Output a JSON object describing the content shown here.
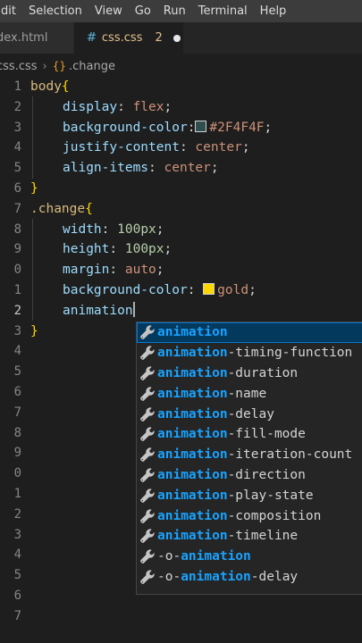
{
  "menu": [
    "dit",
    "Selection",
    "View",
    "Go",
    "Run",
    "Terminal",
    "Help"
  ],
  "tabs": {
    "inactive_label": "dex.html",
    "active_icon": "#",
    "active_label": "css.css",
    "active_problems": "2"
  },
  "breadcrumb": {
    "file": "css.css",
    "symbol": ".change"
  },
  "line_numbers": [
    "1",
    "2",
    "3",
    "4",
    "5",
    "6",
    "7",
    "8",
    "9",
    "0",
    "1",
    "2",
    "3",
    "4",
    "5",
    "6",
    "7",
    "8",
    "9",
    "0",
    "1",
    "2",
    "3",
    "4",
    "5",
    "6",
    "7"
  ],
  "code": {
    "l1_sel": "body",
    "l1_brace": "{",
    "l2_prop": "display",
    "l2_punct": ": ",
    "l2_val": "flex",
    "l2_end": ";",
    "l3_prop": "background-color",
    "l3_punct": ":",
    "l3_val": "#2F4F4F",
    "l3_end": ";",
    "l4_prop": "justify-content",
    "l4_punct": ": ",
    "l4_val": "center",
    "l4_end": ";",
    "l5_prop": "align-items",
    "l5_punct": ": ",
    "l5_val": "center",
    "l5_end": ";",
    "l6_brace": "}",
    "l7_sel": ".change",
    "l7_brace": "{",
    "l8_prop": "width",
    "l8_punct": ": ",
    "l8_num": "100px",
    "l8_end": ";",
    "l9_prop": "height",
    "l9_punct": ": ",
    "l9_num": "100px",
    "l9_end": ";",
    "l10_prop": "margin",
    "l10_punct": ": ",
    "l10_val": "auto",
    "l10_end": ";",
    "l11_prop": "background-color",
    "l11_punct": ": ",
    "l11_val": "gold",
    "l11_end": ";",
    "l12_prop": "animation",
    "l13_brace": "}"
  },
  "colors": {
    "swatch1": "#2F4F4F",
    "swatch2": "#FFD700"
  },
  "suggestions": [
    {
      "match": "animation",
      "rest": "",
      "pre": ""
    },
    {
      "match": "animation",
      "rest": "-timing-function",
      "pre": ""
    },
    {
      "match": "animation",
      "rest": "-duration",
      "pre": ""
    },
    {
      "match": "animation",
      "rest": "-name",
      "pre": ""
    },
    {
      "match": "animation",
      "rest": "-delay",
      "pre": ""
    },
    {
      "match": "animation",
      "rest": "-fill-mode",
      "pre": ""
    },
    {
      "match": "animation",
      "rest": "-iteration-count",
      "pre": ""
    },
    {
      "match": "animation",
      "rest": "-direction",
      "pre": ""
    },
    {
      "match": "animation",
      "rest": "-play-state",
      "pre": ""
    },
    {
      "match": "animation",
      "rest": "-composition",
      "pre": ""
    },
    {
      "match": "animation",
      "rest": "-timeline",
      "pre": ""
    },
    {
      "match": "animation",
      "rest": "",
      "pre": "-o-"
    },
    {
      "match": "animation",
      "rest": "-delay",
      "pre": "-o-"
    }
  ],
  "suggestion_icon": "wrench-icon"
}
